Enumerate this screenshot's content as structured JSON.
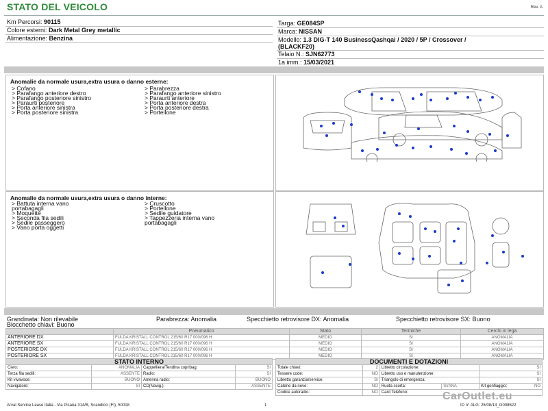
{
  "header": {
    "title": "STATO DEL VEICOLO",
    "rev": "Rev. A"
  },
  "left_info": [
    {
      "label": "Km Percorsi: ",
      "value": "90115"
    },
    {
      "label": "Colore esterni: ",
      "value": "Dark Metal Grey metallic"
    },
    {
      "label": "Alimentazione: ",
      "value": "Benzina"
    }
  ],
  "right_info": {
    "targa": {
      "label": "Targa: ",
      "value": "GE084SP"
    },
    "marca": {
      "label": "Marca: ",
      "value": "NISSAN"
    },
    "modello": {
      "label": "Modello: ",
      "value_line1": "1.3 DIG-T 140 BusinessQashqai / 2020 / 5P / Crossover /",
      "value_line2": "(BLACKF20)"
    },
    "telaio": {
      "label": "Telaio N.: ",
      "value": "SJN62773"
    },
    "imm": {
      "label": "1a imm.: ",
      "value": "15/03/2021"
    }
  },
  "external": {
    "title": "Anomalie da normale usura,extra usura o danno esterne:",
    "col1": [
      "> Cofano",
      "> Parafango anteriore destro",
      "> Parafango posteriore sinistro",
      "> Paraurti posteriore",
      "> Porta anteriore sinistra",
      "> Porta posteriore sinistra"
    ],
    "col2": [
      "> Parabrezza",
      "> Parafango anteriore sinistro",
      "> Paraurti anteriore",
      "> Porta anteriore destra",
      "> Porta posteriore destra",
      "> Portellone"
    ]
  },
  "internal": {
    "title": "Anomalie da normale usura,extra usura o danno interne:",
    "col1": [
      "> Battuta interna vano",
      "portabagagli",
      "> Moquette",
      "> Seconda fila sedili",
      "> Sedile passeggero",
      "> Vano porta oggetti"
    ],
    "col2": [
      "> Cruscotto",
      "> Portellone",
      "> Sedile guidatore",
      "> Tappezzeria interna vano",
      "portabagagli"
    ]
  },
  "summary": {
    "grandinata": "Grandinata: Non rilevabile",
    "chiavi": "Blocchetto chiavi: Buono",
    "parabrezza": "Parabrezza: Anomalia",
    "spec_dx": "Specchietto retrovisore DX: Anomalia",
    "spec_sx": "Specchietto retrovisore SX: Buono"
  },
  "tyres": {
    "headers": [
      "",
      "Pneumatico",
      "Stato",
      "Termiche",
      "Cerchi in lega"
    ],
    "rows": [
      [
        "ANTERIORE DX",
        "FULDA KRISTALL CONTROL  215/60 R17 000/096 H",
        "MEDIO",
        "SI",
        "ANOMALIA"
      ],
      [
        "ANTERIORE SX",
        "FULDA KRISTALL CONTROL  215/60 R17 000/096 H",
        "MEDIO",
        "SI",
        "ANOMALIA"
      ],
      [
        "POSTERIORE DX",
        "FULDA KRISTALL CONTROL  215/60 R17 000/096 H",
        "MEDIO",
        "SI",
        "ANOMALIA"
      ],
      [
        "POSTERIORE SX",
        "FULDA KRISTALL CONTROL  215/60 R17 000/096 H",
        "MEDIO",
        "SI",
        "ANOMALIA"
      ]
    ]
  },
  "interno": {
    "title": "STATO INTERNO",
    "rows": [
      [
        "Cielo:",
        "ANOMALIA",
        "Cappelliera/Tendina copribag:",
        "SI"
      ],
      [
        "Terza fila sedili:",
        "ASSENTE",
        "Radio:",
        "SI"
      ],
      [
        "Kit vivavoce:",
        "BUONO",
        "Antenna radio:",
        "BUONO"
      ],
      [
        "Navigatore:",
        "SI",
        "CD(Navig.):",
        "ASSENTE"
      ]
    ]
  },
  "documenti": {
    "title": "DOCUMENTI E DOTAZIONI",
    "rows": [
      [
        "Totale chiavi:",
        "2",
        "Libretto circolazione:",
        "SI"
      ],
      [
        "Tessere code:",
        "NO",
        "Libretto uso e manutenzione:",
        "SI"
      ],
      [
        "Libretto garanzia/service:",
        "SI",
        "Triangolo di emergenza:",
        "SI"
      ],
      [
        "Catene da neve:",
        "NO",
        "Ruota scorta:",
        "SI/ANA",
        "Kit gonfiaggio:",
        "NO"
      ],
      [
        "Codice autoradio:",
        "NO",
        "Card Telefono:",
        ""
      ]
    ]
  },
  "footer": {
    "company": "Arval Service Lease Italia - Via Pisana 314/B, Scandicci (FI), 50018",
    "page": "1",
    "id": "ID n° ALG: 25/08/14_G008622",
    "watermark": "CarOutlet.eu"
  }
}
